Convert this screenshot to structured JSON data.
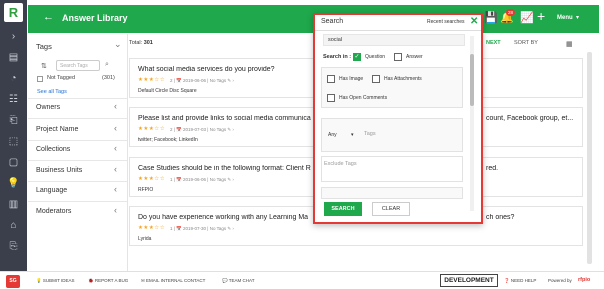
{
  "app": {
    "logo": "R",
    "title": "Answer Library"
  },
  "header": {
    "back_icon": "←",
    "save_icon": "💾",
    "notif_icon": "🔔",
    "notif_count": "28",
    "chart_icon": "📈",
    "add_icon": "+",
    "menu_label": "Menu"
  },
  "sidebar": {
    "icons": [
      "›",
      "▤",
      "◔",
      "☷",
      "⎗",
      "⬚",
      "▢",
      "⬓",
      "▣",
      "💡",
      "▥",
      "⌂",
      "⎘"
    ]
  },
  "filters": {
    "title": "Tags",
    "sort_icon": "⇅",
    "tag_search_placeholder": "Search Tags",
    "not_tagged_label": "Not Tagged",
    "not_tagged_count": "(301)",
    "see_all": "See all Tags",
    "items": [
      "Owners",
      "Project Name",
      "Collections",
      "Business Units",
      "Language",
      "Moderators"
    ]
  },
  "list": {
    "total_label": "Total:",
    "total": "301",
    "next_label": "NEXT",
    "sort_label": "SORT BY",
    "cards": [
      {
        "question": "What social media services do you provide?",
        "rating": "★★★☆☆",
        "meta": "2  |  📅 2019-06-06  |  No Tags  ✎ ›",
        "tags": "Default Circle Disc Square"
      },
      {
        "question": "Please list and provide links to social media communica",
        "tail": "count, Facebook group, et...",
        "rating": "★★★☆☆",
        "meta": "2  |  📅 2019-07-03  |  No Tags  ✎ ›",
        "tags": "twitter; Facebook; LinkedIn"
      },
      {
        "question": "Case Studies should be in the following format: Client R",
        "tail": "red.",
        "rating": "★★★☆☆",
        "meta": "1  |  📅 2019-06-06  |  No Tags  ✎ ›",
        "tags": "RFPIO"
      },
      {
        "question": "Do you have experience working with any Learning Ma",
        "tail": "ch ones?",
        "rating": "★★★☆☆",
        "meta": "1  |  📅 2019-07-30  |  No Tags  ✎ ›",
        "tags": "Lyrida"
      }
    ]
  },
  "footer": {
    "avatar": "SG",
    "links": [
      "SUBMIT IDEAS",
      "REPORT A BUG",
      "EMAIL INTERNAL CONTACT",
      "TEAM CHAT"
    ],
    "env": "DEVELOPMENT",
    "need_help": "NEED HELP",
    "powered_by": "Powered by",
    "brand": "rfpio"
  },
  "search_modal": {
    "title": "Search",
    "recent": "Recent searches",
    "close_icon": "✕",
    "query": "social",
    "search_in_label": "Search in :",
    "question_label": "Question",
    "answer_label": "Answer",
    "has_image": "Has Image",
    "has_attachments": "Has Attachments",
    "has_open_comments": "Has Open Comments",
    "any_option": "Any",
    "tags_placeholder": "Tags",
    "exclude_tags_placeholder": "Exclude Tags",
    "search_button": "SEARCH",
    "clear_button": "CLEAR"
  },
  "colors": {
    "brand_green": "#1fa84c",
    "sidebar_bg": "#3b3f4b",
    "highlight_red": "#e53935"
  }
}
